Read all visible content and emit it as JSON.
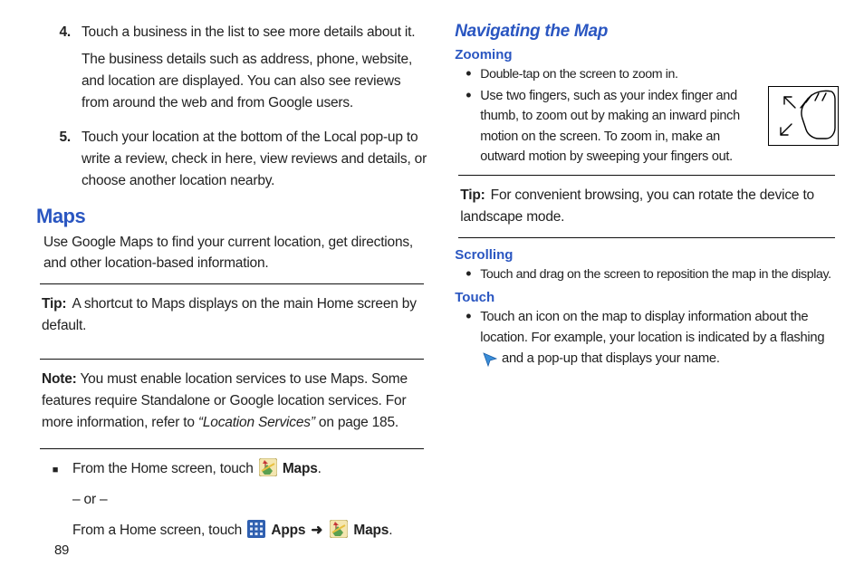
{
  "left": {
    "step4_num": "4.",
    "step4_para1": "Touch a business in the list to see more details about it.",
    "step4_para2": "The business details such as address, phone, website, and location are displayed. You can also see reviews from around the web and from Google users.",
    "step5_num": "5.",
    "step5_text": "Touch your location at the bottom of the Local pop-up to write a review, check in here, view reviews and details, or choose another location nearby.",
    "maps_heading": "Maps",
    "maps_intro": "Use Google Maps to find your current location, get directions, and other location-based information.",
    "tip_label": "Tip:",
    "tip_body": "A shortcut to Maps displays on the main Home screen by default.",
    "note_label": "Note:",
    "note_body_a": "You must enable location services to use Maps. Some features require Standalone or Google location services. For more information, refer to ",
    "note_body_ref": "“Location Services”",
    "note_body_b": "  on page 185.",
    "from_home_a": "From the Home screen, touch ",
    "maps_bold": "Maps",
    "or_text": "– or –",
    "from_home_b": "From a Home screen, touch ",
    "apps_bold": "Apps",
    "arrow": "➜"
  },
  "right": {
    "nav_heading": "Navigating the Map",
    "zoom_heading": "Zooming",
    "zoom_b1": "Double-tap on the screen to zoom in.",
    "zoom_b2": "Use two fingers, such as your index finger and thumb, to zoom out by making an inward pinch motion on the screen. To zoom in, make an outward motion by sweeping your fingers out.",
    "tip_label": "Tip:",
    "tip_body": "For convenient browsing, you can rotate the device to landscape mode.",
    "scroll_heading": "Scrolling",
    "scroll_b1": "Touch and drag on the screen to reposition the map in the display.",
    "touch_heading": "Touch",
    "touch_b1a": "Touch an icon on the map to display information about the location. For example, your location is indicated by a flashing ",
    "touch_b1b": " and a pop-up that displays your name."
  },
  "page_number": "89"
}
